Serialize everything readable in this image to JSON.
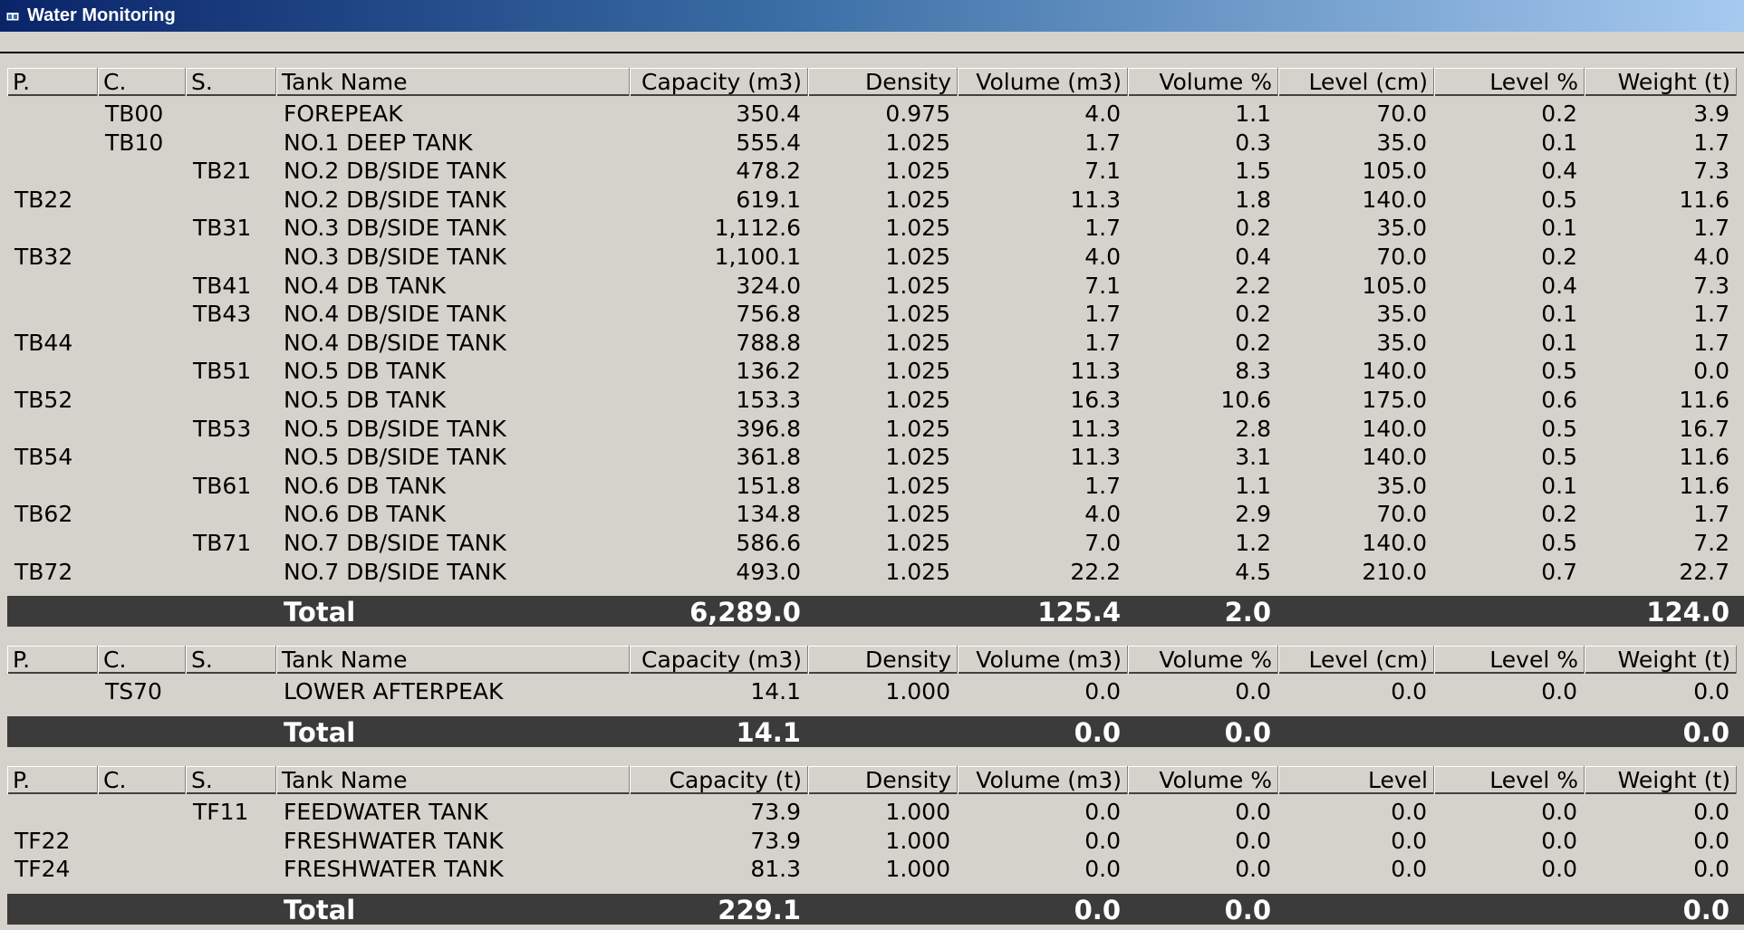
{
  "window": {
    "title": "Water Monitoring",
    "icon": "window-app-icon"
  },
  "colors": {
    "titlebar_start": "#0a246a",
    "titlebar_end": "#a6caf0",
    "background": "#d5d2cb",
    "total_bar": "#3b3b3b"
  },
  "tables": [
    {
      "headers": [
        "P.",
        "C.",
        "S.",
        "Tank Name",
        "Capacity (m3)",
        "Density",
        "Volume (m3)",
        "Volume %",
        "Level (cm)",
        "Level %",
        "Weight (t)"
      ],
      "rows": [
        [
          "",
          "TB00",
          "",
          "FOREPEAK",
          "350.4",
          "0.975",
          "4.0",
          "1.1",
          "70.0",
          "0.2",
          "3.9"
        ],
        [
          "",
          "TB10",
          "",
          "NO.1 DEEP TANK",
          "555.4",
          "1.025",
          "1.7",
          "0.3",
          "35.0",
          "0.1",
          "1.7"
        ],
        [
          "",
          "",
          "TB21",
          "NO.2 DB/SIDE TANK",
          "478.2",
          "1.025",
          "7.1",
          "1.5",
          "105.0",
          "0.4",
          "7.3"
        ],
        [
          "TB22",
          "",
          "",
          "NO.2 DB/SIDE TANK",
          "619.1",
          "1.025",
          "11.3",
          "1.8",
          "140.0",
          "0.5",
          "11.6"
        ],
        [
          "",
          "",
          "TB31",
          "NO.3 DB/SIDE TANK",
          "1,112.6",
          "1.025",
          "1.7",
          "0.2",
          "35.0",
          "0.1",
          "1.7"
        ],
        [
          "TB32",
          "",
          "",
          "NO.3 DB/SIDE TANK",
          "1,100.1",
          "1.025",
          "4.0",
          "0.4",
          "70.0",
          "0.2",
          "4.0"
        ],
        [
          "",
          "",
          "TB41",
          "NO.4 DB TANK",
          "324.0",
          "1.025",
          "7.1",
          "2.2",
          "105.0",
          "0.4",
          "7.3"
        ],
        [
          "",
          "",
          "TB43",
          "NO.4 DB/SIDE TANK",
          "756.8",
          "1.025",
          "1.7",
          "0.2",
          "35.0",
          "0.1",
          "1.7"
        ],
        [
          "TB44",
          "",
          "",
          "NO.4 DB/SIDE TANK",
          "788.8",
          "1.025",
          "1.7",
          "0.2",
          "35.0",
          "0.1",
          "1.7"
        ],
        [
          "",
          "",
          "TB51",
          "NO.5 DB TANK",
          "136.2",
          "1.025",
          "11.3",
          "8.3",
          "140.0",
          "0.5",
          "0.0"
        ],
        [
          "TB52",
          "",
          "",
          "NO.5 DB TANK",
          "153.3",
          "1.025",
          "16.3",
          "10.6",
          "175.0",
          "0.6",
          "11.6"
        ],
        [
          "",
          "",
          "TB53",
          "NO.5 DB/SIDE TANK",
          "396.8",
          "1.025",
          "11.3",
          "2.8",
          "140.0",
          "0.5",
          "16.7"
        ],
        [
          "TB54",
          "",
          "",
          "NO.5 DB/SIDE TANK",
          "361.8",
          "1.025",
          "11.3",
          "3.1",
          "140.0",
          "0.5",
          "11.6"
        ],
        [
          "",
          "",
          "TB61",
          "NO.6 DB TANK",
          "151.8",
          "1.025",
          "1.7",
          "1.1",
          "35.0",
          "0.1",
          "11.6"
        ],
        [
          "TB62",
          "",
          "",
          "NO.6 DB TANK",
          "134.8",
          "1.025",
          "4.0",
          "2.9",
          "70.0",
          "0.2",
          "1.7"
        ],
        [
          "",
          "",
          "TB71",
          "NO.7 DB/SIDE TANK",
          "586.6",
          "1.025",
          "7.0",
          "1.2",
          "140.0",
          "0.5",
          "7.2"
        ],
        [
          "TB72",
          "",
          "",
          "NO.7 DB/SIDE TANK",
          "493.0",
          "1.025",
          "22.2",
          "4.5",
          "210.0",
          "0.7",
          "22.7"
        ]
      ],
      "total": {
        "label": "Total",
        "capacity": "6,289.0",
        "volume": "125.4",
        "volume_pct": "2.0",
        "weight": "124.0"
      }
    },
    {
      "headers": [
        "P.",
        "C.",
        "S.",
        "Tank Name",
        "Capacity (m3)",
        "Density",
        "Volume (m3)",
        "Volume %",
        "Level (cm)",
        "Level %",
        "Weight (t)"
      ],
      "rows": [
        [
          "",
          "TS70",
          "",
          "LOWER AFTERPEAK",
          "14.1",
          "1.000",
          "0.0",
          "0.0",
          "0.0",
          "0.0",
          "0.0"
        ]
      ],
      "total": {
        "label": "Total",
        "capacity": "14.1",
        "volume": "0.0",
        "volume_pct": "0.0",
        "weight": "0.0"
      }
    },
    {
      "headers": [
        "P.",
        "C.",
        "S.",
        "Tank Name",
        "Capacity (t)",
        "Density",
        "Volume (m3)",
        "Volume %",
        "Level",
        "Level %",
        "Weight (t)"
      ],
      "rows": [
        [
          "",
          "",
          "TF11",
          "FEEDWATER TANK",
          "73.9",
          "1.000",
          "0.0",
          "0.0",
          "0.0",
          "0.0",
          "0.0"
        ],
        [
          "TF22",
          "",
          "",
          "FRESHWATER TANK",
          "73.9",
          "1.000",
          "0.0",
          "0.0",
          "0.0",
          "0.0",
          "0.0"
        ],
        [
          "TF24",
          "",
          "",
          "FRESHWATER TANK",
          "81.3",
          "1.000",
          "0.0",
          "0.0",
          "0.0",
          "0.0",
          "0.0"
        ]
      ],
      "total": {
        "label": "Total",
        "capacity": "229.1",
        "volume": "0.0",
        "volume_pct": "0.0",
        "weight": "0.0"
      }
    }
  ]
}
